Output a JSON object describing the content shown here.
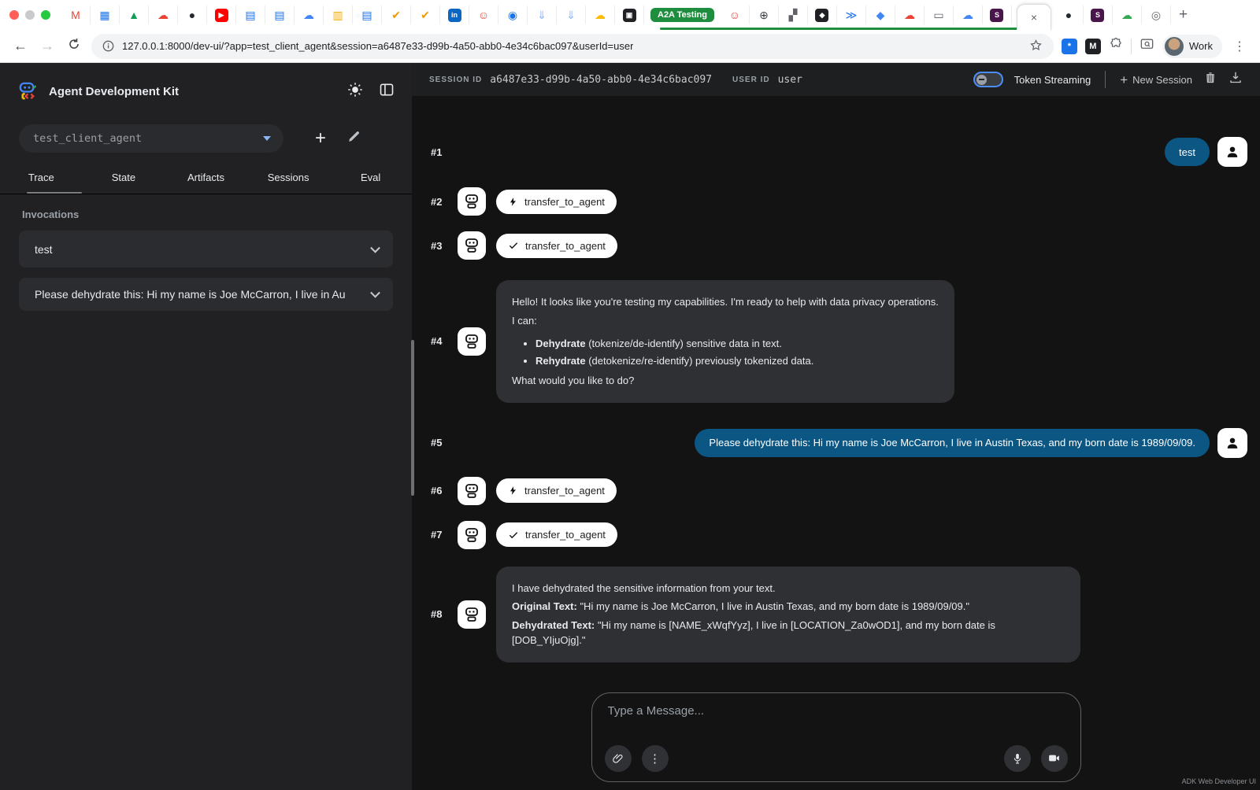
{
  "colors": {
    "user_bubble": "#0b5683",
    "bot_bubble": "#2f3033",
    "accent_blue": "#8ab4f8",
    "tab_group_green": "#1e8e3e"
  },
  "browser": {
    "pinned_tabs": [
      {
        "name": "gmail",
        "glyph": "M",
        "fg": "#ea4335",
        "bg": ""
      },
      {
        "name": "calendar",
        "glyph": "▦",
        "fg": "#1a73e8",
        "bg": ""
      },
      {
        "name": "drive",
        "glyph": "▲",
        "fg": "#0f9d58",
        "bg": ""
      },
      {
        "name": "cloud",
        "glyph": "☁",
        "fg": "#ea4335",
        "bg": ""
      },
      {
        "name": "github",
        "glyph": "●",
        "fg": "#24292f",
        "bg": ""
      },
      {
        "name": "youtube",
        "glyph": "▶",
        "fg": "#ffffff",
        "bg": "#ff0000"
      },
      {
        "name": "docs",
        "glyph": "▤",
        "fg": "#1a73e8",
        "bg": ""
      },
      {
        "name": "docs",
        "glyph": "▤",
        "fg": "#1a73e8",
        "bg": ""
      },
      {
        "name": "cloud",
        "glyph": "☁",
        "fg": "#4285f4",
        "bg": ""
      },
      {
        "name": "slides",
        "glyph": "▥",
        "fg": "#f9ab00",
        "bg": ""
      },
      {
        "name": "docs",
        "glyph": "▤",
        "fg": "#1a73e8",
        "bg": ""
      },
      {
        "name": "check",
        "glyph": "✔",
        "fg": "#f29900",
        "bg": ""
      },
      {
        "name": "check",
        "glyph": "✔",
        "fg": "#f29900",
        "bg": ""
      },
      {
        "name": "linkedin",
        "glyph": "in",
        "fg": "#ffffff",
        "bg": "#0a66c2"
      },
      {
        "name": "robot",
        "glyph": "☺",
        "fg": "#ea4335",
        "bg": ""
      },
      {
        "name": "profile",
        "glyph": "◉",
        "fg": "#1a73e8",
        "bg": ""
      },
      {
        "name": "download",
        "glyph": "⇓",
        "fg": "#8ab4f8",
        "bg": ""
      },
      {
        "name": "download",
        "glyph": "⇓",
        "fg": "#8ab4f8",
        "bg": ""
      },
      {
        "name": "cloud",
        "glyph": "☁",
        "fg": "#fbbc04",
        "bg": ""
      },
      {
        "name": "capture",
        "glyph": "▣",
        "fg": "#ffffff",
        "bg": "#202124"
      }
    ],
    "group": {
      "label": "A2A Testing"
    },
    "group_tabs": [
      {
        "name": "robot",
        "glyph": "☺",
        "fg": "#ea4335",
        "bg": ""
      },
      {
        "name": "globe",
        "glyph": "⊕",
        "fg": "#3c4043",
        "bg": ""
      },
      {
        "name": "qr",
        "glyph": "▞",
        "fg": "#5f6368",
        "bg": ""
      },
      {
        "name": "drop",
        "glyph": "◆",
        "fg": "#ffffff",
        "bg": "#202124"
      },
      {
        "name": "play",
        "glyph": "≫",
        "fg": "#1a73e8",
        "bg": ""
      },
      {
        "name": "sparkle",
        "glyph": "◆",
        "fg": "#4285f4",
        "bg": ""
      },
      {
        "name": "cloud",
        "glyph": "☁",
        "fg": "#ea4335",
        "bg": ""
      },
      {
        "name": "monitor",
        "glyph": "▭",
        "fg": "#5f6368",
        "bg": ""
      },
      {
        "name": "cloud",
        "glyph": "☁",
        "fg": "#4285f4",
        "bg": ""
      },
      {
        "name": "slack",
        "glyph": "S",
        "fg": "#ffffff",
        "bg": "#4a154b"
      }
    ],
    "active_tab": {
      "close_glyph": "×"
    },
    "right_tabs": [
      {
        "name": "github",
        "glyph": "●",
        "fg": "#24292f",
        "bg": ""
      },
      {
        "name": "slack",
        "glyph": "S",
        "fg": "#ffffff",
        "bg": "#4a154b"
      },
      {
        "name": "cloud",
        "glyph": "☁",
        "fg": "#34a853",
        "bg": ""
      },
      {
        "name": "settings",
        "glyph": "◎",
        "fg": "#5f6368",
        "bg": ""
      }
    ],
    "new_tab_glyph": "+",
    "nav": {
      "back": "←",
      "forward": "→"
    },
    "url": "127.0.0.1:8000/dev-ui/?app=test_client_agent&session=a6487e33-d99b-4a50-abb0-4e34c6bac097&userId=user",
    "ext1_glyph": "*",
    "ext2_glyph": "M",
    "profile_label": "Work",
    "kebab_glyph": "⋮"
  },
  "sidebar": {
    "app_title": "Agent Development Kit",
    "agent_select_value": "test_client_agent",
    "tabs": [
      {
        "label": "Trace"
      },
      {
        "label": "State"
      },
      {
        "label": "Artifacts"
      },
      {
        "label": "Sessions"
      },
      {
        "label": "Eval"
      }
    ],
    "invocations_label": "Invocations",
    "invocations": [
      {
        "label": "test"
      },
      {
        "label": "Please dehydrate this: Hi my name is Joe McCarron, I live in Au"
      }
    ]
  },
  "header": {
    "session_label": "SESSION ID",
    "session_id": "a6487e33-d99b-4a50-abb0-4e34c6bac097",
    "user_label": "USER ID",
    "user_id": "user",
    "token_streaming_label": "Token Streaming",
    "new_session_plus": "+",
    "new_session_label": "New Session"
  },
  "events": {
    "e1": {
      "num": "#1",
      "user_text": "test"
    },
    "e2": {
      "num": "#2",
      "tool": "transfer_to_agent"
    },
    "e3": {
      "num": "#3",
      "tool": "transfer_to_agent"
    },
    "e4": {
      "num": "#4",
      "p1": "Hello! It looks like you're testing my capabilities. I'm ready to help with data privacy operations.",
      "p2": "I can:",
      "b1_bold": "Dehydrate",
      "b1_rest": " (tokenize/de-identify) sensitive data in text.",
      "b2_bold": "Rehydrate",
      "b2_rest": " (detokenize/re-identify) previously tokenized data.",
      "p3": "What would you like to do?"
    },
    "e5": {
      "num": "#5",
      "user_text": "Please dehydrate this: Hi my name is Joe McCarron, I live in Austin Texas, and my born date is 1989/09/09."
    },
    "e6": {
      "num": "#6",
      "tool": "transfer_to_agent"
    },
    "e7": {
      "num": "#7",
      "tool": "transfer_to_agent"
    },
    "e8": {
      "num": "#8",
      "l1": "I have dehydrated the sensitive information from your text.",
      "l2_bold": "Original Text:",
      "l2_rest": " \"Hi my name is Joe McCarron, I live in Austin Texas, and my born date is 1989/09/09.\"",
      "l3_bold": "Dehydrated Text:",
      "l3_rest": " \"Hi my name is [NAME_xWqfYyz], I live in [LOCATION_Za0wOD1], and my born date is [DOB_YIjuOjg].\""
    }
  },
  "input": {
    "placeholder": "Type a Message...",
    "kebab_glyph": "⋮"
  },
  "footer_note": "ADK Web Developer UI"
}
